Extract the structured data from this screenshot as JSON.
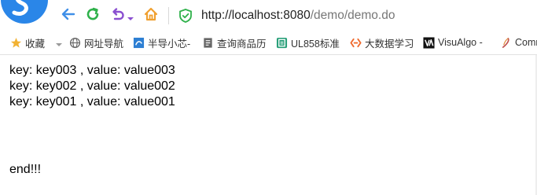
{
  "browser": {
    "logo_icon": "browser-logo-icon",
    "url_host": "http://localhost:8080",
    "url_path": "/demo/demo.do",
    "colors": {
      "nav_blue": "#3f8fe8",
      "refresh_green": "#2fb14b",
      "undo_purple": "#8a4fd0",
      "home_orange": "#f0a030",
      "shield_green": "#2fb14b"
    }
  },
  "bookmarks": {
    "items": [
      {
        "label": "收藏",
        "icon": "star-icon"
      },
      {
        "label": "网址导航",
        "icon": "globe-icon"
      },
      {
        "label": "半导小芯-",
        "icon": "chip-icon"
      },
      {
        "label": "查询商品历",
        "icon": "document-icon"
      },
      {
        "label": "UL858标准",
        "icon": "doc-green-icon"
      },
      {
        "label": "大数据学习",
        "icon": "code-bracket-icon"
      },
      {
        "label": "VisuAlgo -",
        "icon": "visualgo-icon"
      },
      {
        "label": "Comr",
        "icon": "feather-icon"
      }
    ]
  },
  "page": {
    "lines": [
      "key: key003 , value: value003",
      "key: key002 , value: value002",
      "key: key001 , value: value001"
    ],
    "end_text": "end!!!"
  }
}
